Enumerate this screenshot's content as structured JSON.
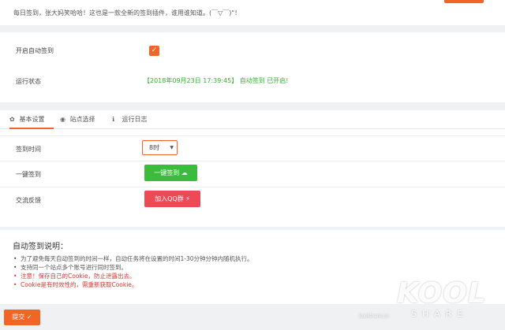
{
  "top": {
    "intro": "每日签到，张大妈笑哈哈！这也是一款全新的签到插件，谁用谁知道。(￣▽￣)\"！"
  },
  "status": {
    "auto_label": "开启自动签到",
    "auto_checked": true,
    "checkmark": "✓",
    "run_label": "运行状态",
    "run_value": "【2018年09月23日 17:39:45】 自动签到 已开启!"
  },
  "tabs": [
    {
      "label": "基本设置",
      "icon": "gear-icon",
      "glyph": "✿",
      "active": true
    },
    {
      "label": "站点选择",
      "icon": "globe-icon",
      "glyph": "◉",
      "active": false
    },
    {
      "label": "运行日志",
      "icon": "info-icon",
      "glyph": "ℹ",
      "active": false
    }
  ],
  "settings": {
    "time_label": "签到时间",
    "time_value": "8时",
    "select_arrow": "▼",
    "oneclick_label": "一键签到",
    "oneclick_button": "一键签到 ☁",
    "feedback_label": "交流反馈",
    "feedback_button": "加入QQ群 ⚡"
  },
  "info": {
    "title": "自动签到说明：",
    "items": [
      {
        "text": "为了避免每天自动签到的时间一样，自动任务将在设置的时间1-30分钟分钟内随机执行。",
        "red": false
      },
      {
        "text": "支持同一个站点多个账号进行同时签到。",
        "red": false
      },
      {
        "text": "注意！保存自己的Cookie，防止泄露出去。",
        "red": true
      },
      {
        "text": "Cookie是有时效性的，需重新获取Cookie。",
        "red": true
      }
    ]
  },
  "submit_label": "提交 ✓",
  "watermark": {
    "logo": "KOOL",
    "share": "SHARE",
    "site": "koolshare.cn"
  },
  "colors": {
    "accent": "#f16626",
    "success": "#2db52b",
    "green_button": "#3dbb3f",
    "red_button": "#ec4b55",
    "warning_text": "#e2302d"
  }
}
